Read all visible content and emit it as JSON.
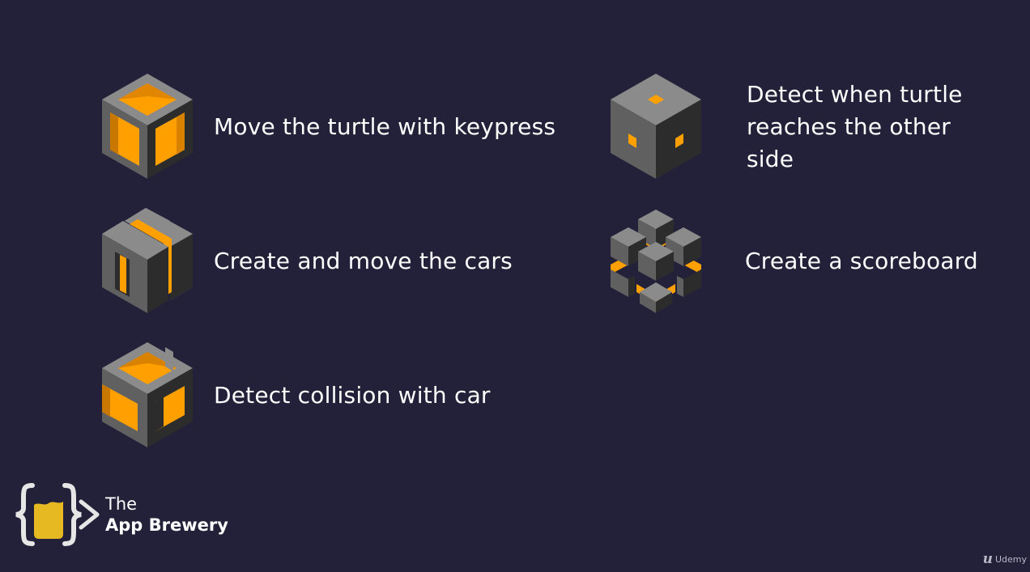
{
  "slide": {
    "items": [
      {
        "label": "Move the turtle with keypress",
        "icon": "hollow-cube-icon"
      },
      {
        "label": "Create and move the cars",
        "icon": "interlocking-blocks-icon"
      },
      {
        "label": "Detect collision with car",
        "icon": "cut-cube-icon"
      },
      {
        "label": "Detect when turtle reaches the other side",
        "icon": "solid-cube-icon"
      },
      {
        "label": "Create a scoreboard",
        "icon": "cube-cluster-icon"
      }
    ]
  },
  "brand": {
    "line1": "The",
    "line2": "App Brewery",
    "icon": "code-braces-logo-icon"
  },
  "watermark": {
    "mark": "u",
    "text": "Udemy"
  },
  "colors": {
    "background": "#23203a",
    "cube_top": "#8b8b8b",
    "cube_left": "#606060",
    "cube_right": "#2c2c2c",
    "accent_orange": "#ffa000",
    "logo_yellow": "#e6b923"
  }
}
